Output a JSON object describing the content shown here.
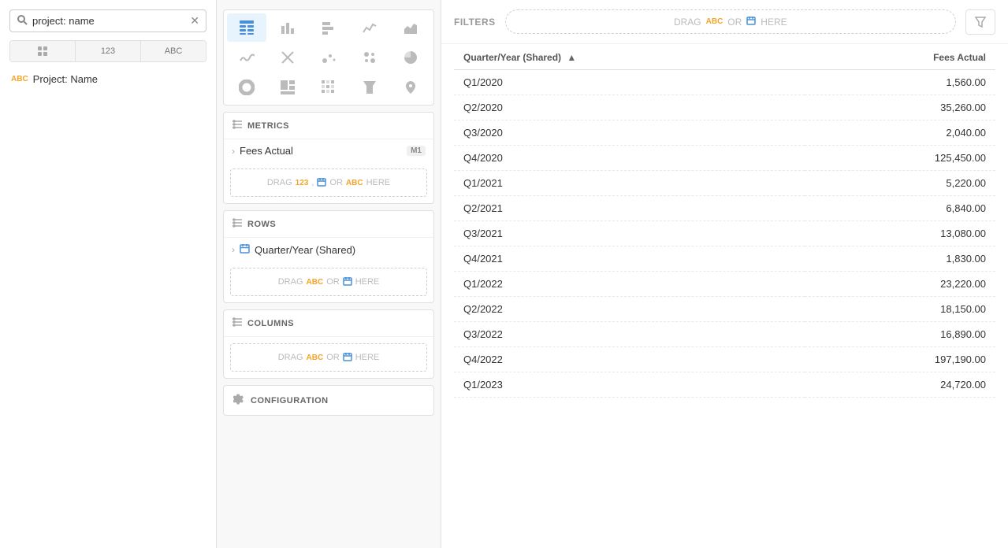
{
  "search": {
    "placeholder": "project: name",
    "value": "project: name"
  },
  "type_buttons": [
    {
      "label": "⊞",
      "id": "grid"
    },
    {
      "label": "123",
      "id": "number"
    },
    {
      "label": "ABC",
      "id": "text"
    }
  ],
  "fields": [
    {
      "type": "ABC",
      "name": "Project: Name"
    }
  ],
  "chart_icons": [
    {
      "id": "table",
      "symbol": "▦",
      "active": true
    },
    {
      "id": "bar",
      "symbol": "▐",
      "active": false
    },
    {
      "id": "bar-h",
      "symbol": "≡",
      "active": false
    },
    {
      "id": "line",
      "symbol": "∿",
      "active": false
    },
    {
      "id": "area",
      "symbol": "⛰",
      "active": false
    },
    {
      "id": "wave",
      "symbol": "∼",
      "active": false
    },
    {
      "id": "cross",
      "symbol": "✕",
      "active": false
    },
    {
      "id": "scatter",
      "symbol": "⁙",
      "active": false
    },
    {
      "id": "bubble",
      "symbol": "◉",
      "active": false
    },
    {
      "id": "pie",
      "symbol": "◔",
      "active": false
    },
    {
      "id": "donut",
      "symbol": "◎",
      "active": false
    },
    {
      "id": "treemap",
      "symbol": "▪",
      "active": false
    },
    {
      "id": "heatmap",
      "symbol": "▦",
      "active": false
    },
    {
      "id": "funnel",
      "symbol": "⬇",
      "active": false
    },
    {
      "id": "map",
      "symbol": "📍",
      "active": false
    }
  ],
  "metrics_section": {
    "label": "METRICS",
    "items": [
      {
        "name": "Fees Actual",
        "badge": "M1"
      }
    ],
    "drag_label": "DRAG",
    "drag_or": "OR",
    "drag_here": "HERE"
  },
  "rows_section": {
    "label": "ROWS",
    "items": [
      {
        "name": "Quarter/Year (Shared)"
      }
    ],
    "drag_label": "DRAG",
    "drag_or": "OR",
    "drag_here": "HERE"
  },
  "columns_section": {
    "label": "COLUMNS",
    "drag_label": "DRAG",
    "drag_or": "OR",
    "drag_here": "HERE"
  },
  "configuration_section": {
    "label": "CONFIGURATION"
  },
  "filters": {
    "label": "FILTERS",
    "drag_label": "DRAG",
    "drag_abc": "ABC",
    "drag_or": "OR",
    "drag_here": "HERE"
  },
  "table": {
    "columns": [
      {
        "id": "quarter",
        "label": "Quarter/Year (Shared)",
        "sortable": true,
        "sort_dir": "asc",
        "align": "left"
      },
      {
        "id": "fees",
        "label": "Fees Actual",
        "sortable": false,
        "align": "right"
      }
    ],
    "rows": [
      {
        "quarter": "Q1/2020",
        "fees": "1,560.00"
      },
      {
        "quarter": "Q2/2020",
        "fees": "35,260.00"
      },
      {
        "quarter": "Q3/2020",
        "fees": "2,040.00"
      },
      {
        "quarter": "Q4/2020",
        "fees": "125,450.00"
      },
      {
        "quarter": "Q1/2021",
        "fees": "5,220.00"
      },
      {
        "quarter": "Q2/2021",
        "fees": "6,840.00"
      },
      {
        "quarter": "Q3/2021",
        "fees": "13,080.00"
      },
      {
        "quarter": "Q4/2021",
        "fees": "1,830.00"
      },
      {
        "quarter": "Q1/2022",
        "fees": "23,220.00"
      },
      {
        "quarter": "Q2/2022",
        "fees": "18,150.00"
      },
      {
        "quarter": "Q3/2022",
        "fees": "16,890.00"
      },
      {
        "quarter": "Q4/2022",
        "fees": "197,190.00"
      },
      {
        "quarter": "Q1/2023",
        "fees": "24,720.00"
      }
    ]
  },
  "colors": {
    "accent_orange": "#f4a428",
    "accent_blue": "#4a90d9",
    "text_muted": "#aaa",
    "border": "#e0e0e0"
  }
}
